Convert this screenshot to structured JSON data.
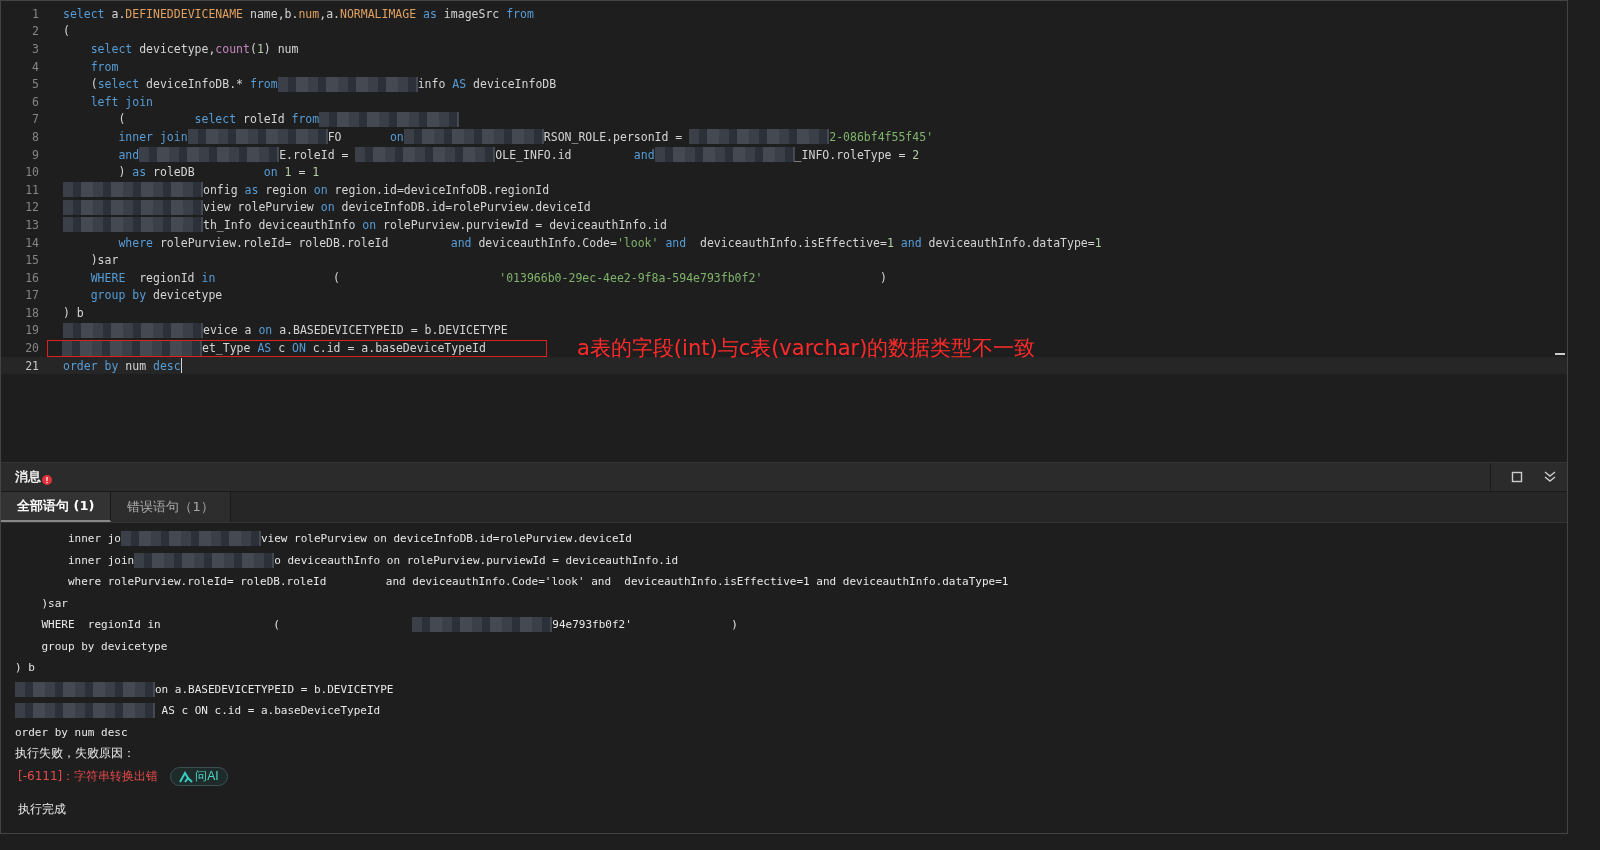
{
  "editor": {
    "lines": [
      {
        "number": "1",
        "current": false,
        "tokens": [
          {
            "kind": "kw",
            "text": "select"
          },
          {
            "kind": "id",
            "text": " a."
          },
          {
            "kind": "col",
            "text": "DEFINEDDEVICENAME"
          },
          {
            "kind": "id",
            "text": " name,b."
          },
          {
            "kind": "col",
            "text": "num"
          },
          {
            "kind": "id",
            "text": ",a."
          },
          {
            "kind": "col",
            "text": "NORMALIMAGE"
          },
          {
            "kind": "kw",
            "text": " as"
          },
          {
            "kind": "id",
            "text": " imageSrc "
          },
          {
            "kind": "kw",
            "text": "from"
          }
        ]
      },
      {
        "number": "2",
        "current": false,
        "tokens": [
          {
            "kind": "id",
            "text": "("
          }
        ]
      },
      {
        "number": "3",
        "current": false,
        "tokens": [
          {
            "kind": "kw",
            "text": "    select"
          },
          {
            "kind": "id",
            "text": " devicetype,"
          },
          {
            "kind": "fn",
            "text": "count"
          },
          {
            "kind": "id",
            "text": "("
          },
          {
            "kind": "num",
            "text": "1"
          },
          {
            "kind": "id",
            "text": ") num"
          }
        ]
      },
      {
        "number": "4",
        "current": false,
        "tokens": [
          {
            "kind": "kw",
            "text": "    from"
          }
        ]
      },
      {
        "number": "5",
        "current": false,
        "tokens": [
          {
            "kind": "id",
            "text": "    ("
          },
          {
            "kind": "kw",
            "text": "select"
          },
          {
            "kind": "id",
            "text": " deviceInfoDB.* "
          },
          {
            "kind": "kw",
            "text": "from"
          },
          {
            "kind": "redacted"
          },
          {
            "kind": "id",
            "text": "info "
          },
          {
            "kind": "kw",
            "text": "AS"
          },
          {
            "kind": "id",
            "text": " deviceInfoDB"
          }
        ]
      },
      {
        "number": "6",
        "current": false,
        "tokens": [
          {
            "kind": "kw",
            "text": "    left join"
          }
        ]
      },
      {
        "number": "7",
        "current": false,
        "tokens": [
          {
            "kind": "id",
            "text": "        (          "
          },
          {
            "kind": "kw",
            "text": "select"
          },
          {
            "kind": "id",
            "text": " roleId "
          },
          {
            "kind": "kw",
            "text": "from"
          },
          {
            "kind": "redacted"
          }
        ]
      },
      {
        "number": "8",
        "current": false,
        "tokens": [
          {
            "kind": "kw",
            "text": "        inner join"
          },
          {
            "kind": "redacted"
          },
          {
            "kind": "id",
            "text": "FO       "
          },
          {
            "kind": "kw",
            "text": "on"
          },
          {
            "kind": "redacted"
          },
          {
            "kind": "id",
            "text": "RSON_ROLE.personId = "
          },
          {
            "kind": "redacted"
          },
          {
            "kind": "str",
            "text": "2-086bf4f55f45'"
          }
        ]
      },
      {
        "number": "9",
        "current": false,
        "tokens": [
          {
            "kind": "kw",
            "text": "        and"
          },
          {
            "kind": "redacted"
          },
          {
            "kind": "id",
            "text": "E.roleId = "
          },
          {
            "kind": "redacted"
          },
          {
            "kind": "id",
            "text": "OLE_INFO.id         "
          },
          {
            "kind": "kw",
            "text": "and"
          },
          {
            "kind": "redacted"
          },
          {
            "kind": "id",
            "text": "_INFO.roleType = "
          },
          {
            "kind": "num",
            "text": "2"
          }
        ]
      },
      {
        "number": "10",
        "current": false,
        "tokens": [
          {
            "kind": "id",
            "text": "        ) "
          },
          {
            "kind": "kw",
            "text": "as"
          },
          {
            "kind": "id",
            "text": " roleDB          "
          },
          {
            "kind": "kw",
            "text": "on"
          },
          {
            "kind": "num",
            "text": " 1"
          },
          {
            "kind": "id",
            "text": " = "
          },
          {
            "kind": "num",
            "text": "1"
          }
        ]
      },
      {
        "number": "11",
        "current": false,
        "tokens": [
          {
            "kind": "redacted"
          },
          {
            "kind": "id",
            "text": "onfig "
          },
          {
            "kind": "kw",
            "text": "as"
          },
          {
            "kind": "id",
            "text": " region "
          },
          {
            "kind": "kw",
            "text": "on"
          },
          {
            "kind": "id",
            "text": " region.id=deviceInfoDB.regionId"
          }
        ]
      },
      {
        "number": "12",
        "current": false,
        "tokens": [
          {
            "kind": "redacted"
          },
          {
            "kind": "id",
            "text": "view rolePurview "
          },
          {
            "kind": "kw",
            "text": "on"
          },
          {
            "kind": "id",
            "text": " deviceInfoDB.id=rolePurview.deviceId"
          }
        ]
      },
      {
        "number": "13",
        "current": false,
        "tokens": [
          {
            "kind": "redacted"
          },
          {
            "kind": "id",
            "text": "th_Info deviceauthInfo "
          },
          {
            "kind": "kw",
            "text": "on"
          },
          {
            "kind": "id",
            "text": " rolePurview.purviewId = deviceauthInfo.id"
          }
        ]
      },
      {
        "number": "14",
        "current": false,
        "tokens": [
          {
            "kind": "kw",
            "text": "        where"
          },
          {
            "kind": "id",
            "text": " rolePurview.roleId= roleDB.roleId         "
          },
          {
            "kind": "kw",
            "text": "and"
          },
          {
            "kind": "id",
            "text": " deviceauthInfo.Code="
          },
          {
            "kind": "str",
            "text": "'look'"
          },
          {
            "kind": "kw",
            "text": " and"
          },
          {
            "kind": "id",
            "text": "  deviceauthInfo.isEffective="
          },
          {
            "kind": "num",
            "text": "1"
          },
          {
            "kind": "kw",
            "text": " and"
          },
          {
            "kind": "id",
            "text": " deviceauthInfo.dataType="
          },
          {
            "kind": "num",
            "text": "1"
          }
        ]
      },
      {
        "number": "15",
        "current": false,
        "tokens": [
          {
            "kind": "id",
            "text": "    )sar"
          }
        ]
      },
      {
        "number": "16",
        "current": false,
        "tokens": [
          {
            "kind": "kw",
            "text": "    WHERE"
          },
          {
            "kind": "id",
            "text": "  regionId "
          },
          {
            "kind": "kw",
            "text": "in"
          },
          {
            "kind": "id",
            "text": "                 (                       "
          },
          {
            "kind": "str",
            "text": "'013966b0-29ec-4ee2-9f8a-594e793fb0f2'"
          },
          {
            "kind": "id",
            "text": "                 )"
          }
        ]
      },
      {
        "number": "17",
        "current": false,
        "tokens": [
          {
            "kind": "kw",
            "text": "    group by"
          },
          {
            "kind": "id",
            "text": " devicetype"
          }
        ]
      },
      {
        "number": "18",
        "current": false,
        "tokens": [
          {
            "kind": "id",
            "text": ") b"
          }
        ]
      },
      {
        "number": "19",
        "current": false,
        "tokens": [
          {
            "kind": "redacted"
          },
          {
            "kind": "id",
            "text": "evice a "
          },
          {
            "kind": "kw",
            "text": "on"
          },
          {
            "kind": "id",
            "text": " a.BASEDEVICETYPEID = b.DEVICETYPE"
          }
        ]
      },
      {
        "number": "20",
        "current": false,
        "note": "a表的字段(int)与c表(varchar)的数据类型不一致",
        "tokens": [
          {
            "kind": "redacted"
          },
          {
            "kind": "id",
            "text": "et_Type "
          },
          {
            "kind": "kw",
            "text": "AS"
          },
          {
            "kind": "id",
            "text": " c "
          },
          {
            "kind": "kw",
            "text": "ON"
          },
          {
            "kind": "id",
            "text": " c.id = a.baseDeviceTypeId"
          }
        ]
      },
      {
        "number": "21",
        "current": true,
        "tokens": [
          {
            "kind": "kw",
            "text": "order by"
          },
          {
            "kind": "id",
            "text": " num "
          },
          {
            "kind": "kw",
            "text": "desc"
          }
        ]
      }
    ]
  },
  "messages": {
    "title": "消息",
    "tabs": [
      {
        "label": "全部语句 (1)",
        "selected": true
      },
      {
        "label": "错误语句（1）",
        "selected": false
      }
    ],
    "output": [
      {
        "kind": "log",
        "tokens": [
          {
            "kind": "id",
            "text": "        inner jo"
          },
          {
            "kind": "redacted"
          },
          {
            "kind": "id",
            "text": "view rolePurview on deviceInfoDB.id=rolePurview.deviceId"
          }
        ]
      },
      {
        "kind": "log",
        "tokens": [
          {
            "kind": "id",
            "text": "        inner join"
          },
          {
            "kind": "redacted"
          },
          {
            "kind": "id",
            "text": "o deviceauthInfo on rolePurview.purviewId = deviceauthInfo.id"
          }
        ]
      },
      {
        "kind": "log",
        "tokens": [
          {
            "kind": "id",
            "text": "        where rolePurview.roleId= roleDB.roleId         and deviceauthInfo.Code='look' and  deviceauthInfo.isEffective=1 and deviceauthInfo.dataType=1"
          }
        ]
      },
      {
        "kind": "log",
        "tokens": [
          {
            "kind": "id",
            "text": "    )sar"
          }
        ]
      },
      {
        "kind": "log",
        "tokens": [
          {
            "kind": "id",
            "text": "    WHERE  regionId in                 (                    "
          },
          {
            "kind": "redacted"
          },
          {
            "kind": "id",
            "text": "94e793fb0f2'               )"
          }
        ]
      },
      {
        "kind": "log",
        "tokens": [
          {
            "kind": "id",
            "text": "    group by devicetype"
          }
        ]
      },
      {
        "kind": "log",
        "tokens": [
          {
            "kind": "id",
            "text": ") b"
          }
        ]
      },
      {
        "kind": "log",
        "tokens": [
          {
            "kind": "redacted"
          },
          {
            "kind": "id",
            "text": "on a.BASEDEVICETYPEID = b.DEVICETYPE"
          }
        ]
      },
      {
        "kind": "log",
        "tokens": [
          {
            "kind": "redacted"
          },
          {
            "kind": "id",
            "text": " AS c ON c.id = a.baseDeviceTypeId"
          }
        ]
      },
      {
        "kind": "log",
        "tokens": [
          {
            "kind": "id",
            "text": "order by num desc"
          }
        ]
      },
      {
        "kind": "status",
        "text": "执行失败，失败原因："
      },
      {
        "kind": "error",
        "text": "[-6111]：字符串转换出错",
        "button": "问AI"
      },
      {
        "kind": "done",
        "text": "执行完成"
      }
    ]
  }
}
